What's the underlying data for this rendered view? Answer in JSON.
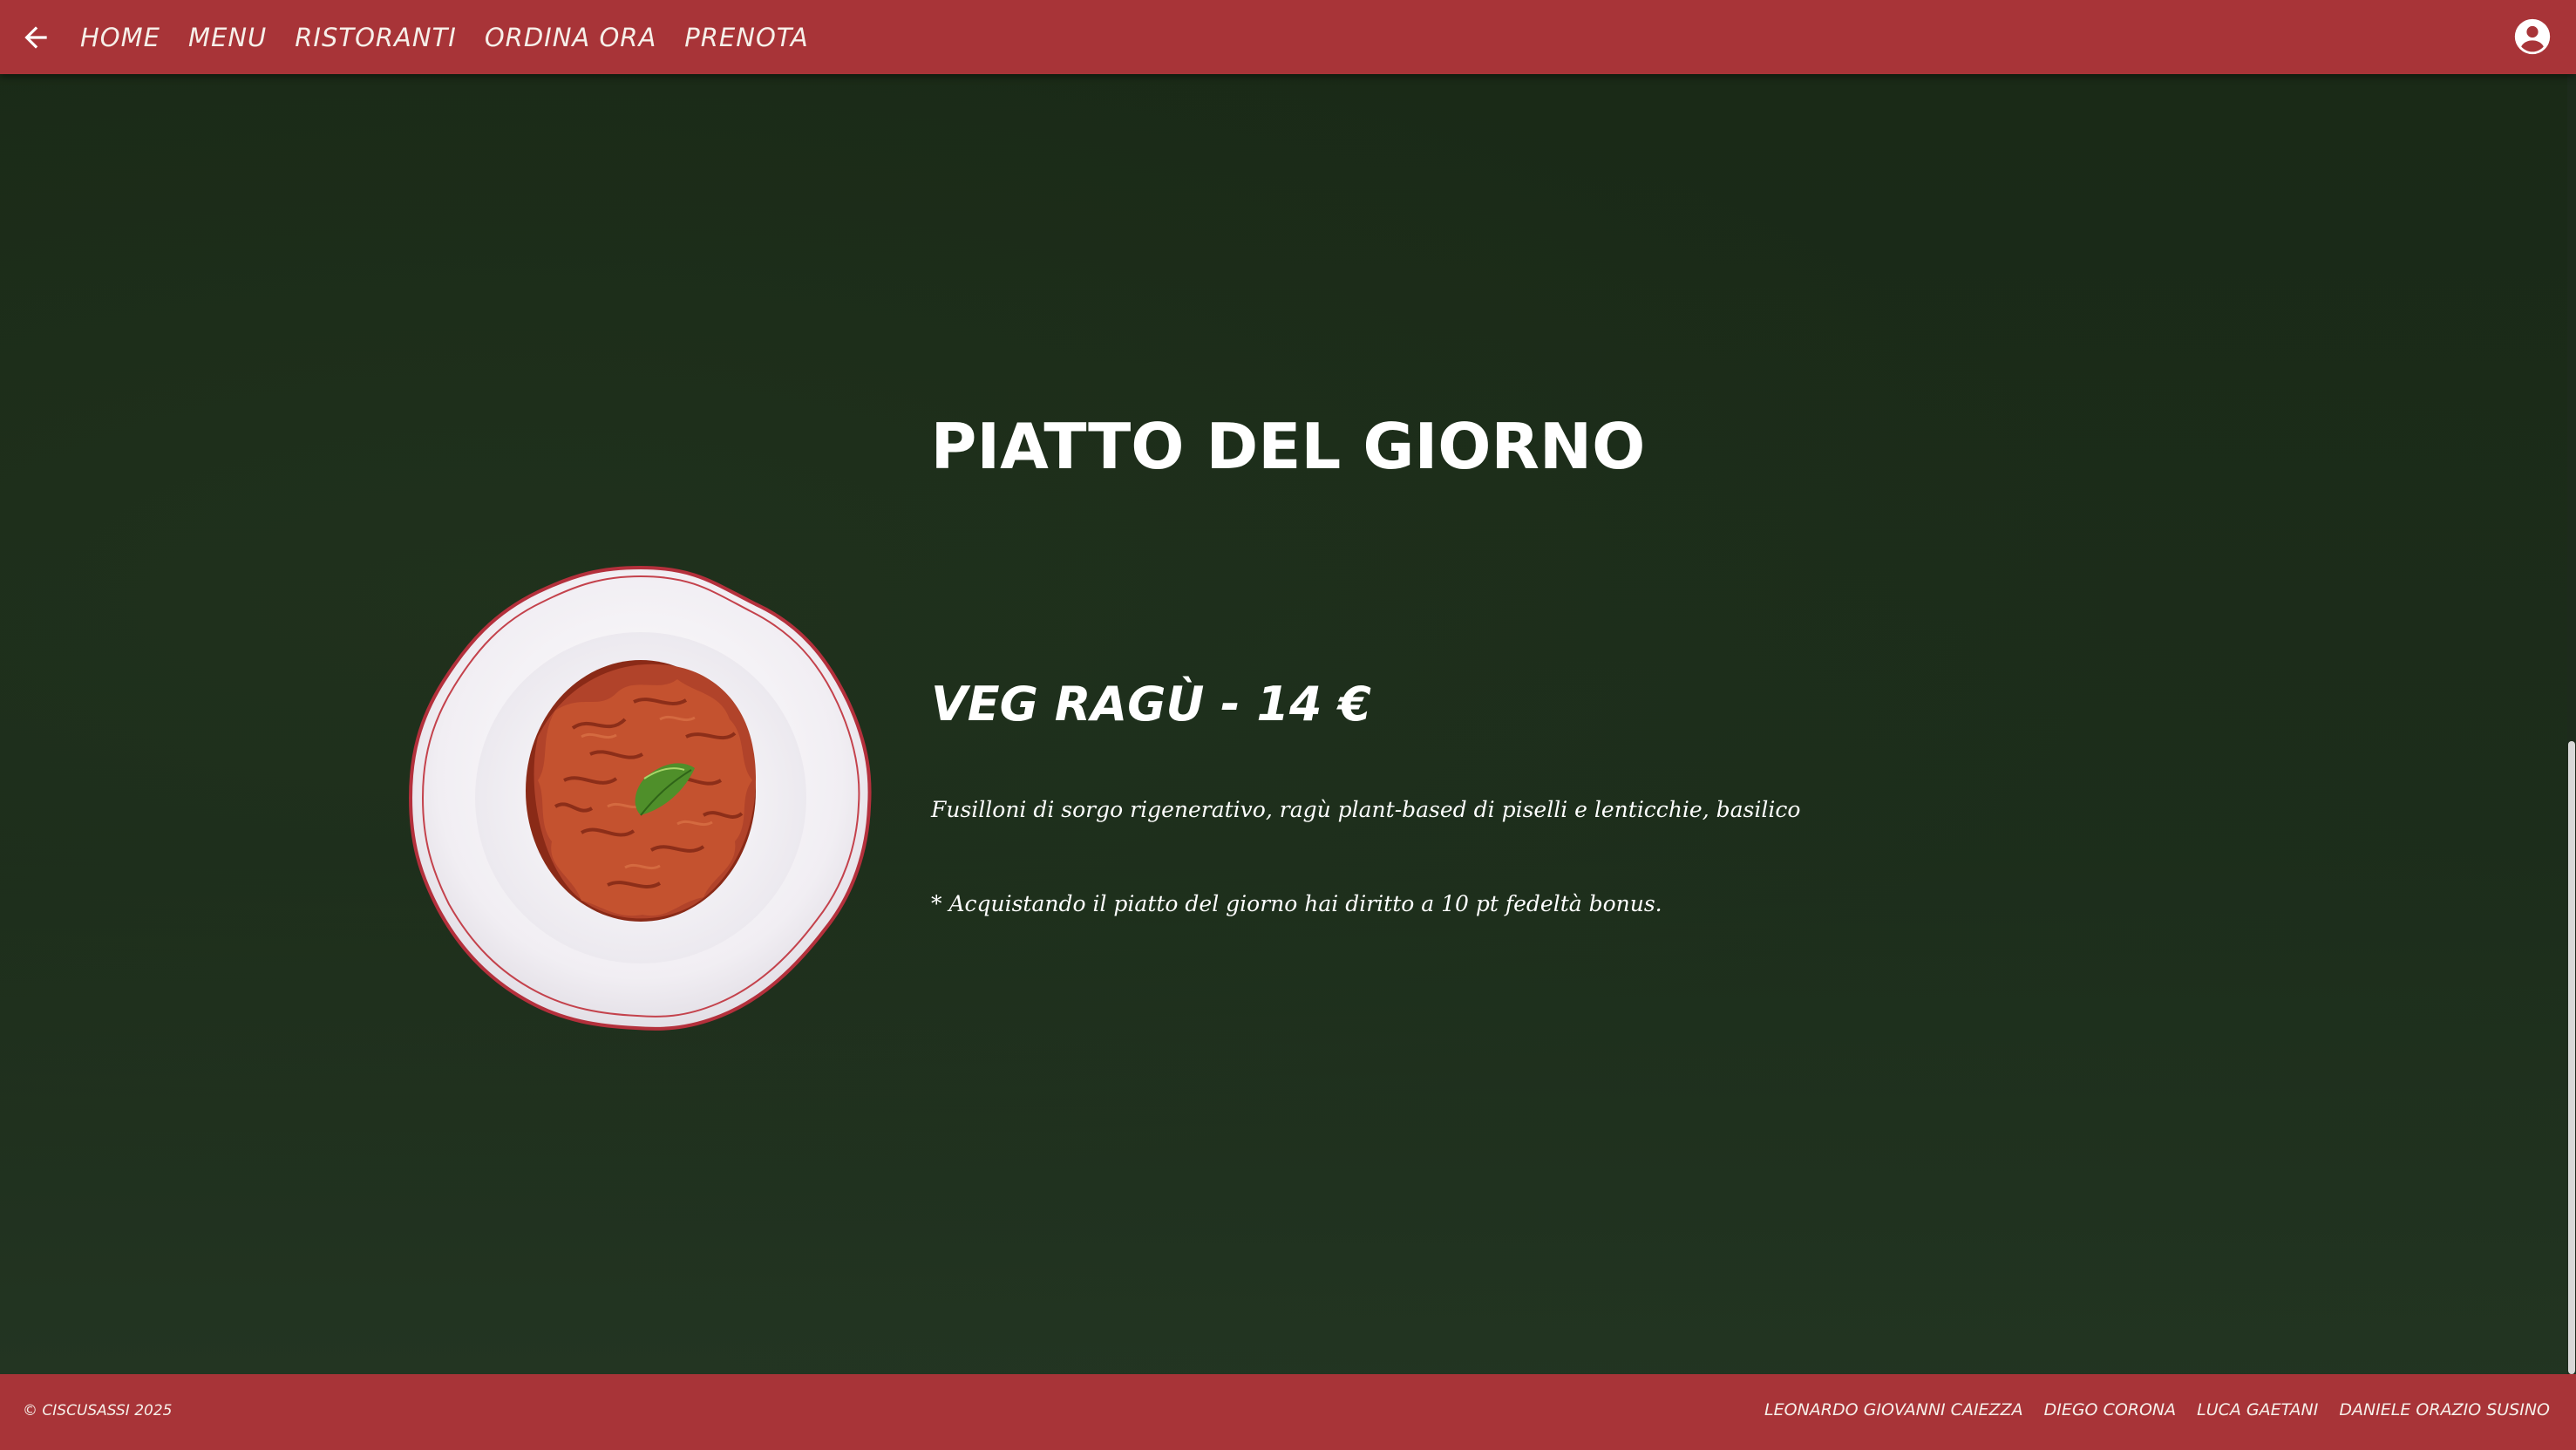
{
  "nav": {
    "links": [
      {
        "label": "HOME"
      },
      {
        "label": "MENU"
      },
      {
        "label": "RISTORANTI"
      },
      {
        "label": "ORDINA ORA"
      },
      {
        "label": "PRENOTA"
      }
    ]
  },
  "main": {
    "section_title": "PIATTO DEL GIORNO",
    "dish": {
      "name": "VEG RAGÙ - 14 €",
      "description": "Fusilloni di sorgo rigenerativo, ragù plant-based di piselli e lenticchie, basilico",
      "note": "* Acquistando il piatto del giorno hai diritto a 10 pt fedeltà bonus."
    }
  },
  "footer": {
    "copyright": "© CISCUSASSI 2025",
    "authors": [
      "LEONARDO GIOVANNI CAIEZZA",
      "DIEGO CORONA",
      "LUCA GAETANI",
      "DANIELE ORAZIO SUSINO"
    ]
  },
  "colors": {
    "brand_red": "#a83438",
    "background_green": "#1b2b19",
    "text": "#ffffff"
  },
  "icons": {
    "back": "arrow-left-icon",
    "account": "account-circle-icon"
  }
}
